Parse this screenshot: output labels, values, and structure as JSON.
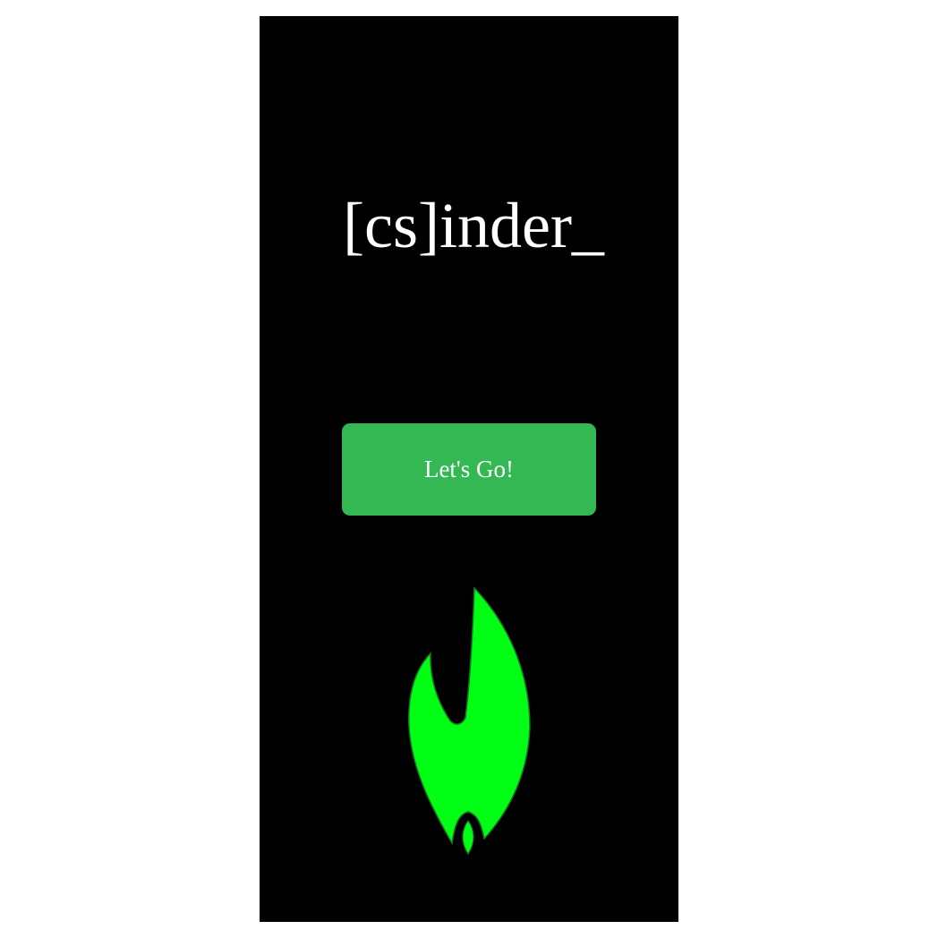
{
  "app": {
    "title": "[cs]inder_"
  },
  "cta": {
    "label": "Let's Go!"
  },
  "logo": {
    "icon": "flame-icon",
    "fill": "#00ff14",
    "stroke": "#1a7a20"
  },
  "colors": {
    "background": "#000000",
    "button": "#33b853",
    "text": "#ffffff"
  }
}
